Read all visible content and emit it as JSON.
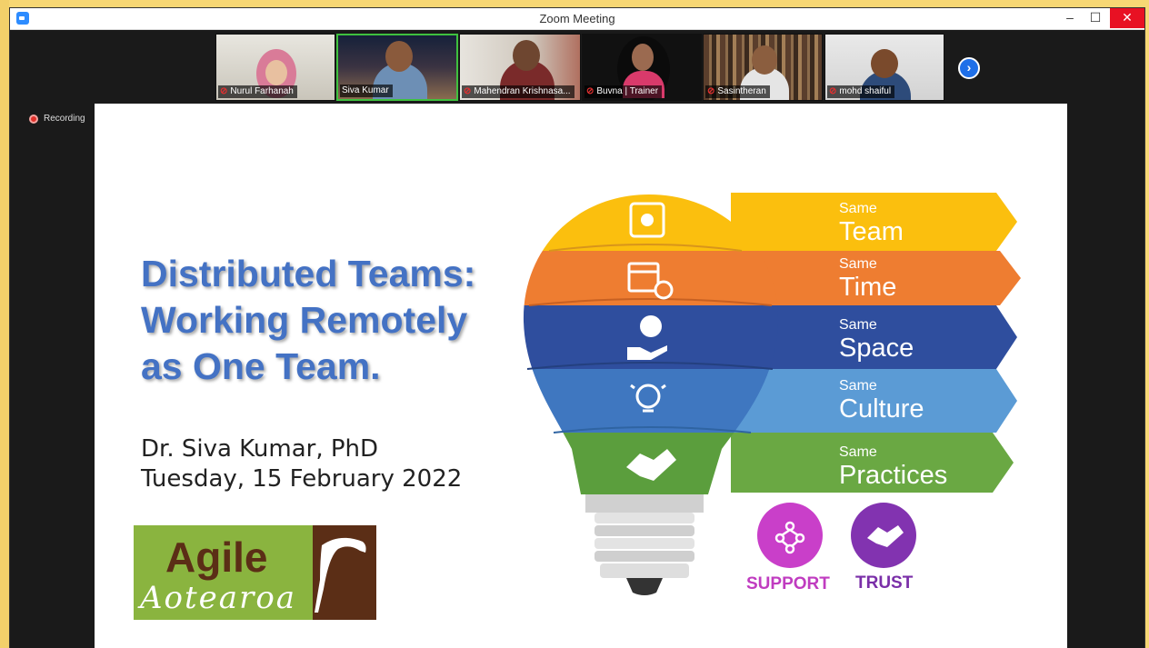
{
  "window": {
    "title": "Zoom Meeting",
    "minimize": "–",
    "maximize": "☐",
    "close": "✕"
  },
  "participants": [
    {
      "name": "Nurul Farhanah",
      "muted": true,
      "active": false
    },
    {
      "name": "Siva Kumar",
      "muted": false,
      "active": true
    },
    {
      "name": "Mahendran Krishnasa...",
      "muted": true,
      "active": false
    },
    {
      "name": "Buvna | Trainer",
      "muted": true,
      "active": false
    },
    {
      "name": "Sasintheran",
      "muted": true,
      "active": false
    },
    {
      "name": "mohd shaiful",
      "muted": true,
      "active": false
    }
  ],
  "next_page_icon": "chevron-right-icon",
  "recording": {
    "label": "Recording"
  },
  "slide": {
    "title": "Distributed Teams:\nWorking Remotely\nas One Team.",
    "author": "Dr. Siva Kumar, PhD",
    "date": "Tuesday, 15 February 2022",
    "logo": {
      "word1": "Agile",
      "word2": "Aotearoa"
    },
    "bulb_items": [
      {
        "small": "Same",
        "big": "Team",
        "color": "#fbbf0e",
        "icon": "money-icon"
      },
      {
        "small": "Same",
        "big": "Time",
        "color": "#ee7d31",
        "icon": "calendar-clock-icon"
      },
      {
        "small": "Same",
        "big": "Space",
        "color": "#2f4e9e",
        "icon": "globe-hand-icon"
      },
      {
        "small": "Same",
        "big": "Culture",
        "color": "#5b9bd5",
        "icon": "lightbulb-idea-icon"
      },
      {
        "small": "Same",
        "big": "Practices",
        "color": "#6aa843",
        "icon": "handshake-icon"
      }
    ],
    "values": [
      {
        "label": "SUPPORT",
        "color": "#c03cc0",
        "icon": "network-icon"
      },
      {
        "label": "TRUST",
        "color": "#7a2fa8",
        "icon": "handshake-icon"
      }
    ]
  }
}
